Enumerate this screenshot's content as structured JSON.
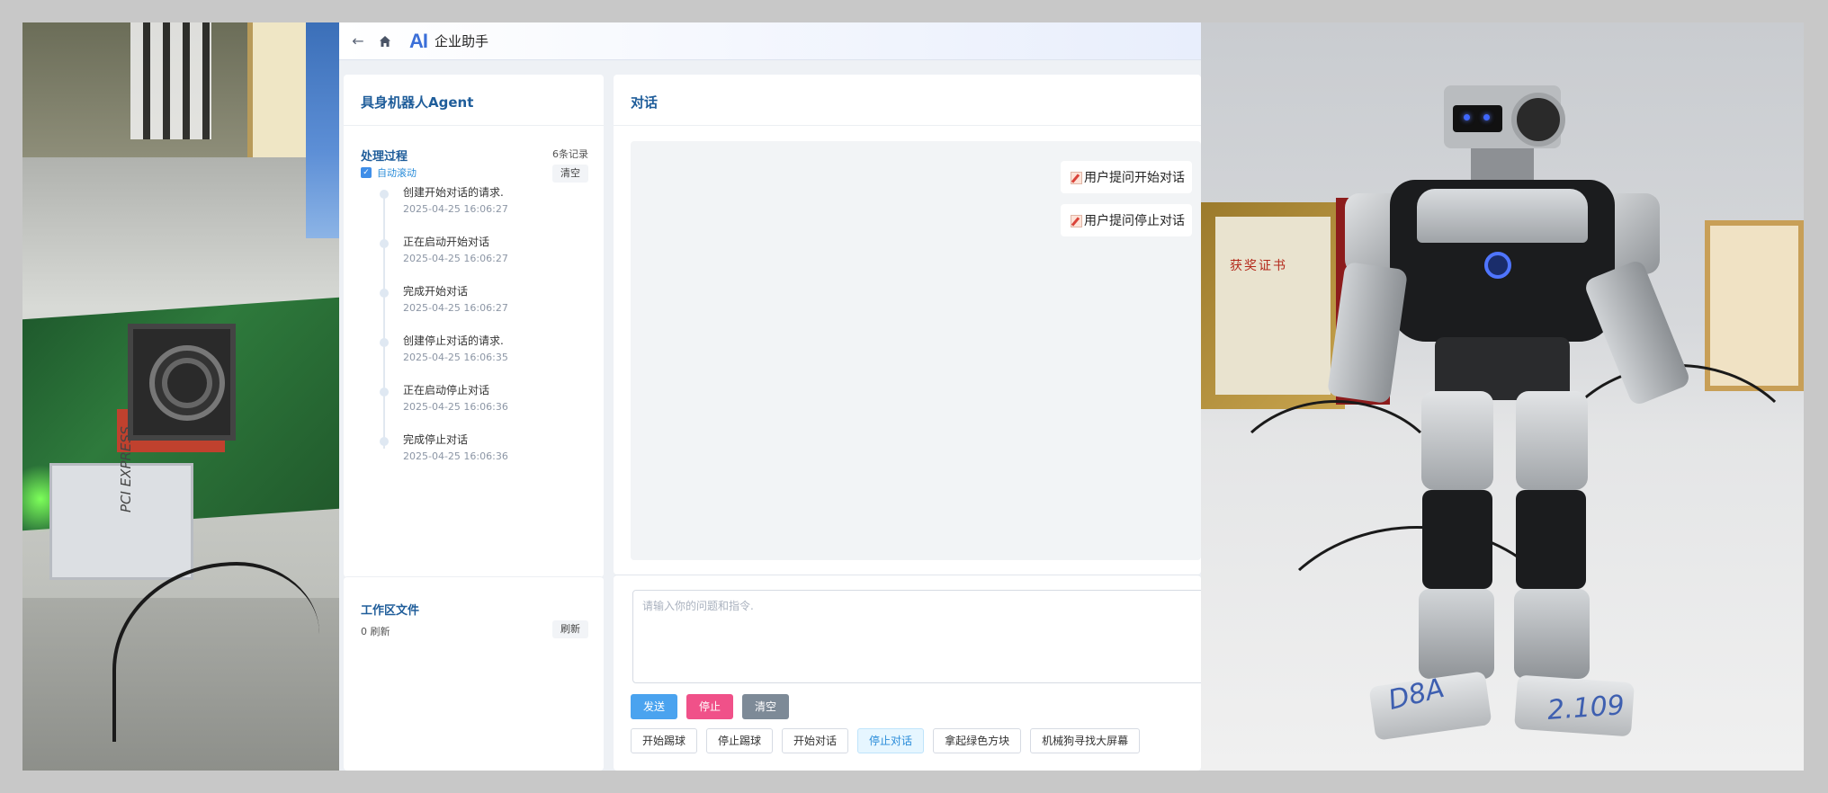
{
  "topbar": {
    "back_icon": "arrow-left-icon",
    "home_icon": "home-icon",
    "logo": "AI",
    "title": "企业助手"
  },
  "left_panel": {
    "title": "具身机器人Agent",
    "process_title": "处理过程",
    "record_count": "6条记录",
    "autoscroll_label": "自动滚动",
    "autoscroll_checked": true,
    "clear_label": "清空",
    "timeline": [
      {
        "text": "创建开始对话的请求.",
        "time": "2025-04-25 16:06:27"
      },
      {
        "text": "正在启动开始对话",
        "time": "2025-04-25 16:06:27"
      },
      {
        "text": "完成开始对话",
        "time": "2025-04-25 16:06:27"
      },
      {
        "text": "创建停止对话的请求.",
        "time": "2025-04-25 16:06:35"
      },
      {
        "text": "正在启动停止对话",
        "time": "2025-04-25 16:06:36"
      },
      {
        "text": "完成停止对话",
        "time": "2025-04-25 16:06:36"
      }
    ],
    "workspace_title": "工作区文件",
    "workspace_count": "0 刷新",
    "refresh_label": "刷新"
  },
  "chat": {
    "title": "对话",
    "messages": [
      {
        "text": "用户提问开始对话"
      },
      {
        "text": "用户提问停止对话"
      }
    ],
    "input_placeholder": "请输入你的问题和指令.",
    "send_label": "发送",
    "stop_label": "停止",
    "clear_label": "清空",
    "quick_actions": [
      "开始踢球",
      "停止踢球",
      "开始对话",
      "停止对话",
      "拿起绿色方块",
      "机械狗寻找大屏幕"
    ],
    "active_quick_action": "停止对话"
  },
  "photos": {
    "left_card_label": "PCI EXPRESS",
    "right_certificate_title": "获奖证书",
    "right_foot_text_left": "D8A",
    "right_foot_text_right": "2.109"
  },
  "colors": {
    "accent_blue": "#1f5d9a",
    "send": "#4aa3ef",
    "stop": "#f05189",
    "clear": "#7d8a97",
    "active_quick": "#e6f6ff"
  }
}
